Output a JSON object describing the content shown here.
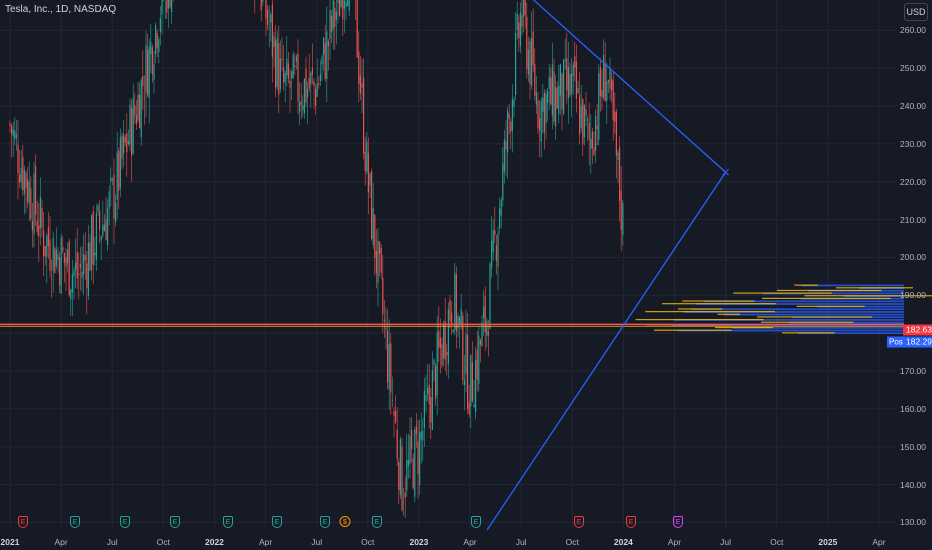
{
  "header": {
    "symbol_title": "Tesla, Inc., 1D, NASDAQ",
    "currency_button": "USD"
  },
  "colors": {
    "background": "#161a25",
    "grid": "#232734",
    "up_candle": "#26a69a",
    "down_candle": "#ef5350",
    "trend_line": "#2962ff",
    "horizontal_level": "#ff5252",
    "volume_profile_up": "#ffc400",
    "volume_profile_down": "#2962ff"
  },
  "price_axis": {
    "labels": [
      "260.00",
      "250.00",
      "240.00",
      "230.00",
      "220.00",
      "210.00",
      "200.00",
      "190.00",
      "170.00",
      "160.00",
      "150.00",
      "140.00",
      "130.00"
    ]
  },
  "time_axis": {
    "labels": [
      {
        "text": "2021",
        "year": true
      },
      {
        "text": "Apr",
        "year": false
      },
      {
        "text": "Jul",
        "year": false
      },
      {
        "text": "Oct",
        "year": false
      },
      {
        "text": "2022",
        "year": true
      },
      {
        "text": "Apr",
        "year": false
      },
      {
        "text": "Jul",
        "year": false
      },
      {
        "text": "Oct",
        "year": false
      },
      {
        "text": "2023",
        "year": true
      },
      {
        "text": "Apr",
        "year": false
      },
      {
        "text": "Jul",
        "year": false
      },
      {
        "text": "Oct",
        "year": false
      },
      {
        "text": "2024",
        "year": true
      },
      {
        "text": "Apr",
        "year": false
      },
      {
        "text": "Jul",
        "year": false
      },
      {
        "text": "Oct",
        "year": false
      },
      {
        "text": "2025",
        "year": true
      },
      {
        "text": "Apr",
        "year": false
      }
    ]
  },
  "price_badges": {
    "last_price": "182.63",
    "post_label": "Post",
    "post_price": "182.29"
  },
  "event_markers": [
    {
      "label": "E",
      "kind": "earnings-down"
    },
    {
      "label": "E",
      "kind": "earnings-up"
    },
    {
      "label": "E",
      "kind": "earnings-up"
    },
    {
      "label": "E",
      "kind": "earnings-up"
    },
    {
      "label": "E",
      "kind": "earnings-up"
    },
    {
      "label": "E",
      "kind": "earnings-up"
    },
    {
      "label": "E",
      "kind": "earnings-up"
    },
    {
      "label": "$",
      "kind": "split"
    },
    {
      "label": "E",
      "kind": "earnings-up"
    },
    {
      "label": "E",
      "kind": "earnings-up"
    },
    {
      "label": "E",
      "kind": "earnings-down"
    },
    {
      "label": "E",
      "kind": "earnings-down"
    },
    {
      "label": "E",
      "kind": "upcoming"
    }
  ],
  "chart_data": {
    "type": "candlestick",
    "symbol": "Tesla, Inc., 1D, NASDAQ",
    "y_range": [
      128,
      268
    ],
    "x_range": [
      "2021-01",
      "2025-05"
    ],
    "grid": true,
    "last_price": 182.63,
    "post_market_price": 182.29,
    "horizontal_level": 182.3,
    "close_series": {
      "dates": [
        "2021-01",
        "2021-03",
        "2021-05",
        "2021-07",
        "2021-09",
        "2021-10",
        "2022-01",
        "2022-03",
        "2022-05",
        "2022-07",
        "2022-09",
        "2022-10",
        "2022-12",
        "2023-01",
        "2023-03",
        "2023-04",
        "2023-05",
        "2023-07",
        "2023-08",
        "2023-10",
        "2023-11",
        "2023-12",
        "2024-01"
      ],
      "values": [
        235,
        205,
        195,
        215,
        250,
        270,
        295,
        285,
        245,
        245,
        280,
        220,
        140,
        150,
        190,
        165,
        185,
        265,
        240,
        245,
        230,
        250,
        208
      ]
    },
    "trend_lines": [
      {
        "from": {
          "date": "2023-06",
          "price": 275
        },
        "to": {
          "date": "2024-07",
          "price": 222.5
        }
      },
      {
        "from": {
          "date": "2023-05",
          "price": 128
        },
        "to": {
          "date": "2024-07",
          "price": 222.5
        }
      }
    ],
    "volume_profile_range": [
      180,
      193
    ]
  }
}
